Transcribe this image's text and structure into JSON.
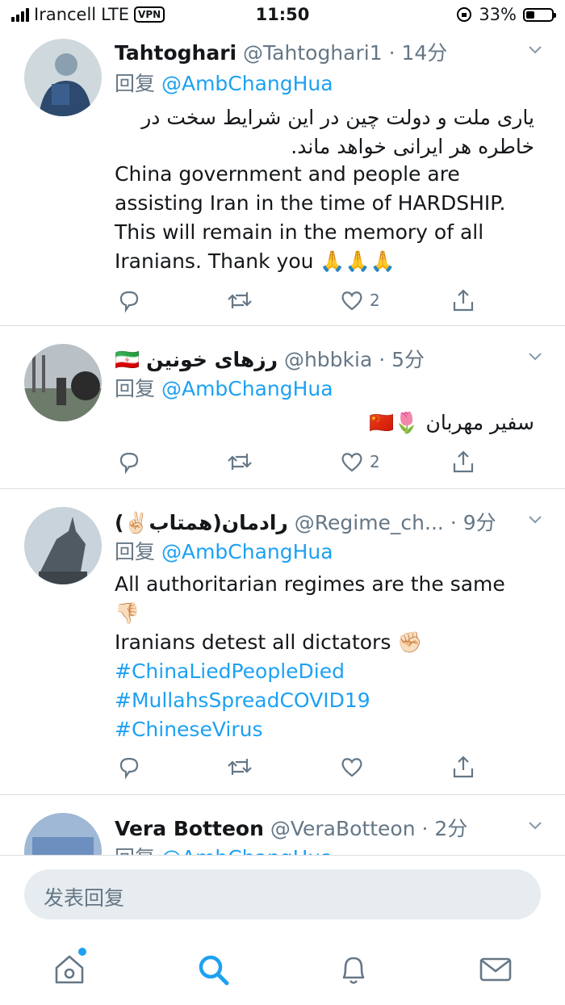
{
  "status": {
    "carrier": "Irancell",
    "network": "LTE",
    "vpn": "VPN",
    "time": "11:50",
    "battery": "33%"
  },
  "tweets": [
    {
      "name": "Tahtoghari",
      "handle": "@Tahtoghari1",
      "time": "· 14分",
      "reply_prefix": "回复",
      "reply_to": "@AmbChangHua",
      "lines": [
        "یاری ملت و دولت چین در این شرایط سخت در",
        "خاطره هر ایرانی خواهد ماند."
      ],
      "body": [
        "China government and people are",
        "assisting Iran in the time of HARDSHIP.",
        "This will remain in the memory of all",
        "Iranians. Thank you 🙏🙏🙏"
      ],
      "likes": "2"
    },
    {
      "name": "رزهای خونین",
      "flag": "🇮🇷",
      "handle": "@hbbkia",
      "time": "· 5分",
      "reply_prefix": "回复",
      "reply_to": "@AmbChangHua",
      "body": [
        "سفیر مهربان 🌷🇨🇳"
      ],
      "likes": "2"
    },
    {
      "name": "رادمان(همتاب✌🏻)",
      "handle": "@Regime_ch...",
      "time": "· 9分",
      "reply_prefix": "回复",
      "reply_to": "@AmbChangHua",
      "body": [
        "All  authoritarian regimes are the same",
        "👎🏻",
        "Iranians detest all dictators ✊🏻"
      ],
      "hashtags": [
        "#ChinaLiedPeopleDied",
        "#MullahsSpreadCOVID19",
        "#ChineseVirus"
      ],
      "likes": ""
    },
    {
      "name": "Vera Botteon",
      "handle": "@VeraBotteon",
      "time": "· 2分",
      "reply_prefix": "回复",
      "reply_to": "@AmbChangHua"
    }
  ],
  "composer": {
    "placeholder": "发表回复"
  },
  "tabs": [
    "home-icon",
    "search-icon",
    "notifications-icon",
    "messages-icon"
  ],
  "colors": {
    "accent": "#1da1f2",
    "muted": "#657786"
  }
}
